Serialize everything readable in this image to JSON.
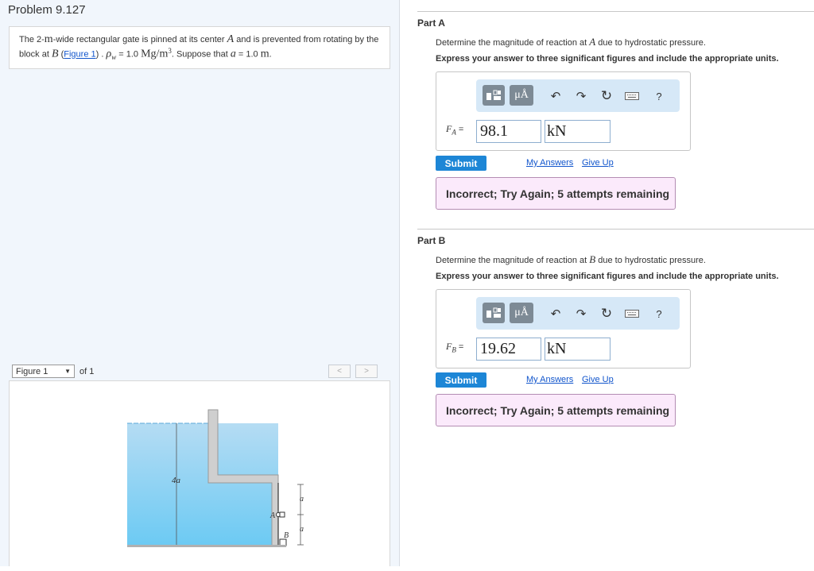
{
  "problem": {
    "title": "Problem 9.127",
    "statement": {
      "t1": "The 2-",
      "t1_unit": "m",
      "t2": "-wide rectangular gate is pinned at its center ",
      "point_a": "A",
      "t3": " and is prevented from rotating by the block at ",
      "point_b": "B",
      "t4": " (",
      "figure_link": "Figure 1",
      "t5": ") . ",
      "rho": "ρ",
      "rho_sub": "w",
      "t6": " = 1.0 ",
      "density_unit": "Mg/m",
      "density_exp": "3",
      "t7": ". Suppose that ",
      "var_a": "a",
      "t8": " = 1.0 ",
      "length_unit": "m",
      "t9": "."
    }
  },
  "figure_nav": {
    "selected": "Figure 1",
    "of_text": "of 1",
    "prev_icon": "chevron-left",
    "next_icon": "chevron-right"
  },
  "figure": {
    "label_4a": "4a",
    "label_a_upper": "a",
    "label_a_lower": "a",
    "label_A": "A",
    "label_B": "B",
    "colors": {
      "water_top": "#b5dcf3",
      "water_bottom": "#6ccaf3",
      "concrete": "#cfcfcf"
    }
  },
  "parts": [
    {
      "title": "Part A",
      "question_pre": "Determine the magnitude of reaction at ",
      "question_point": "A",
      "question_post": " due to hydrostatic pressure.",
      "instructions": "Express your answer to three significant figures and include the appropriate units.",
      "answer_symbol": "F",
      "answer_sub": "A",
      "answer_eq": " =",
      "value": "98.1",
      "unit": "kN",
      "submit": "Submit",
      "my_answers": "My Answers",
      "give_up": "Give Up",
      "feedback": "Incorrect; Try Again; 5 attempts remaining"
    },
    {
      "title": "Part B",
      "question_pre": "Determine the magnitude of reaction at ",
      "question_point": "B",
      "question_post": " due to hydrostatic pressure.",
      "instructions": "Express your answer to three significant figures and include the appropriate units.",
      "answer_symbol": "F",
      "answer_sub": "B",
      "answer_eq": " =",
      "value": "19.62",
      "unit": "kN",
      "submit": "Submit",
      "my_answers": "My Answers",
      "give_up": "Give Up",
      "feedback": "Incorrect; Try Again; 5 attempts remaining"
    }
  ],
  "toolbar": {
    "units_label": "μÅ",
    "help_label": "?",
    "icons": [
      "templates-icon",
      "units-icon",
      "undo-icon",
      "redo-icon",
      "reset-icon",
      "keyboard-icon",
      "help-icon"
    ]
  }
}
